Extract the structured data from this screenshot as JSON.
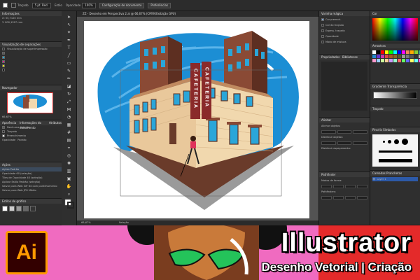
{
  "control_bar": {
    "fill_label": "",
    "stroke_label": "Traçado",
    "stroke_value": "",
    "brush_value": "5 pt. Red.",
    "style_label": "Estilo",
    "opacity_label": "Opacidade",
    "opacity_value": "100%",
    "doc_setup_button": "Configuração de documento",
    "prefs_button": "Preferências"
  },
  "left": {
    "info_title": "Informações",
    "info_x": "X: 55,7120 mm",
    "info_y": "Y: 000,1527 mm",
    "separations_title": "Visualização de separações",
    "overprint_label": "Visualização de superimpressão",
    "navigator_title": "Navegador",
    "navigator_zoom": "66,67%",
    "appearance_tab": "Aparência",
    "doc_info_tab": "Informações do documento",
    "attributes_tab": "Atributos",
    "no_selection": "Nenhuma seleção",
    "stroke_row": "Traçado",
    "fill_row": "Preenchimento",
    "opacity_row": "Opacidade",
    "opacity_row_value": "Padrão",
    "actions_title": "Ações",
    "actions": [
      "Ações Padrão",
      "Opacidade 60 (seleção)",
      "Tiles de Opacidade 40 (seleção)",
      "Aplicar Estilo Padrão (seleção)",
      "Salvar para Web GIF 64 com pontilhamento",
      "Salvar para Web JPG Médio"
    ],
    "graphic_styles_title": "Estilos de gráfico"
  },
  "document": {
    "tab_title": "ZZ - Desenho em Perspectiva 2.ai @ 66,67% (CMYK/Exibição GPU)",
    "zoom_value": "66,67%",
    "status_value": "Seleção"
  },
  "artwork": {
    "sign_left": "CAFETERIA",
    "sign_right": "CAFETERIA"
  },
  "right_mid": {
    "magic_wand_title": "Varinha mágica",
    "fill_color": "Cor preench.",
    "stroke_color": "Cor do traçado",
    "stroke_width": "Espess. traçado",
    "opacity": "Opacidade",
    "blend_mode": "Modo de mistura",
    "properties_tab": "Propriedades",
    "library_tab": "Bibliotecas",
    "align_title": "Alinhar",
    "align_objects": "Alinhar objetos:",
    "distribute_objects": "Distribuir objetos:",
    "distribute_spacing": "Distribuir espaçamento:",
    "pathfinder_title": "Pathfinder",
    "shape_modes": "Modos de forma:",
    "pathfinders": "Pathfinders:"
  },
  "right_col": {
    "color_title": "Cor",
    "swatches_title": "Amostras",
    "gradient_title": "Gradiente",
    "transparency_title": "Transparência",
    "stroke_title": "Traçado",
    "brushes_title": "Pincéis",
    "symbols_title": "Símbolos",
    "layers_title": "Camadas",
    "artboards_title": "Pranchetas",
    "layer_name": "Layer 1"
  },
  "colors": {
    "ui_dark": "#2a2a2a",
    "canvas_gray": "#535353",
    "banner_pink": "#f06bc0",
    "banner_red": "#e42a2a",
    "ai_orange": "#ff9a00",
    "ai_bg": "#330000",
    "sky_blue": "#1c8ed4",
    "building_brown": "#8a4a35",
    "brick_cream": "#f1d8ae"
  },
  "banner": {
    "logo_text": "Ai",
    "title": "Illustrator",
    "subtitle": "Desenho Vetorial | Criação"
  }
}
